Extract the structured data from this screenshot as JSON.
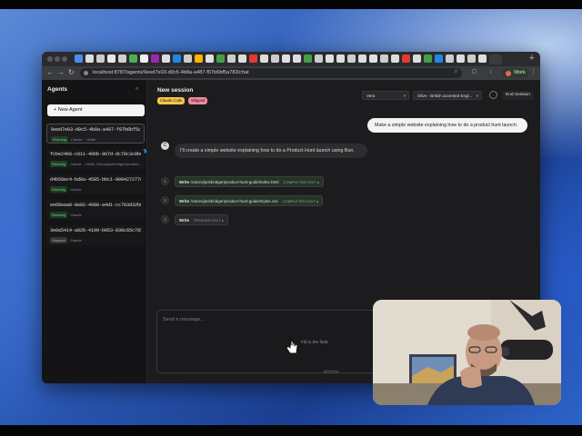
{
  "browser": {
    "url": "localhost:8787/agents/9eed7e03-d0c5-4b8a-a487-f07b6bf5a783/chat",
    "profile_label": "Work"
  },
  "sidebar": {
    "title": "Agents",
    "new_agent_label": "+ New Agent",
    "agents": [
      {
        "id": "9eed7e03-d0c5-4b8a-a487-f07b6bf5a783",
        "status": "Running",
        "agent": "Claude",
        "detail": "• Write"
      },
      {
        "id": "fcbe24b8-c811-46bb-967d-dc78c3c0bd03",
        "status": "Running",
        "agent": "Claude",
        "detail": "• Write /Users/jackbridger/product..."
      },
      {
        "id": "d4b58ec4-bd8a-4585-bbc1-900427277c177",
        "status": "Running",
        "agent": "Claude",
        "detail": ""
      },
      {
        "id": "ee68eaa0-8e82-4608-a4d1-cc783d32b633",
        "status": "Running",
        "agent": "Claude",
        "detail": ""
      },
      {
        "id": "3e0a5414-a826-4109-b053-838c65c78555",
        "status": "Stopped",
        "agent": "Claude",
        "detail": ""
      }
    ]
  },
  "session": {
    "title": "New session",
    "tags": [
      "Claude Code",
      "Shipped"
    ],
    "voice_select": "Vera",
    "model_select": "Olive - British accented Engl...",
    "end_session_label": "End Session"
  },
  "chat": {
    "user_message": "Make a simple website explaining how to do a product hunt launch.",
    "assistant_avatar": "C",
    "assistant_message": "I'll create a simple website explaining how to do a Product Hunt launch using Bun.",
    "tool_calls": [
      {
        "step": "1",
        "name": "Write",
        "path": "/Users/jackbridger/product-hunt-guide/index.html",
        "status": "COMPLETED EDIT ▸"
      },
      {
        "step": "2",
        "name": "Write",
        "path": "/Users/jackbridger/product-hunt-guide/styles.css",
        "status": "COMPLETED EDIT ▸"
      },
      {
        "step": "3",
        "name": "Write",
        "path": "",
        "status": "PENDING EDIT ▸"
      }
    ]
  },
  "composer": {
    "placeholder": "Send a message...",
    "hint": "Fill in the field."
  },
  "colors": {
    "accent_running": "#7bd27f",
    "tag_claude": "#f5c84c",
    "tag_shipped": "#f28b9c",
    "unread": "#3d8bfd"
  },
  "icons": {
    "collapse": "chevron-left-double-icon",
    "cursor": "pointer-cursor-icon",
    "webcam": "webcam-overlay"
  }
}
